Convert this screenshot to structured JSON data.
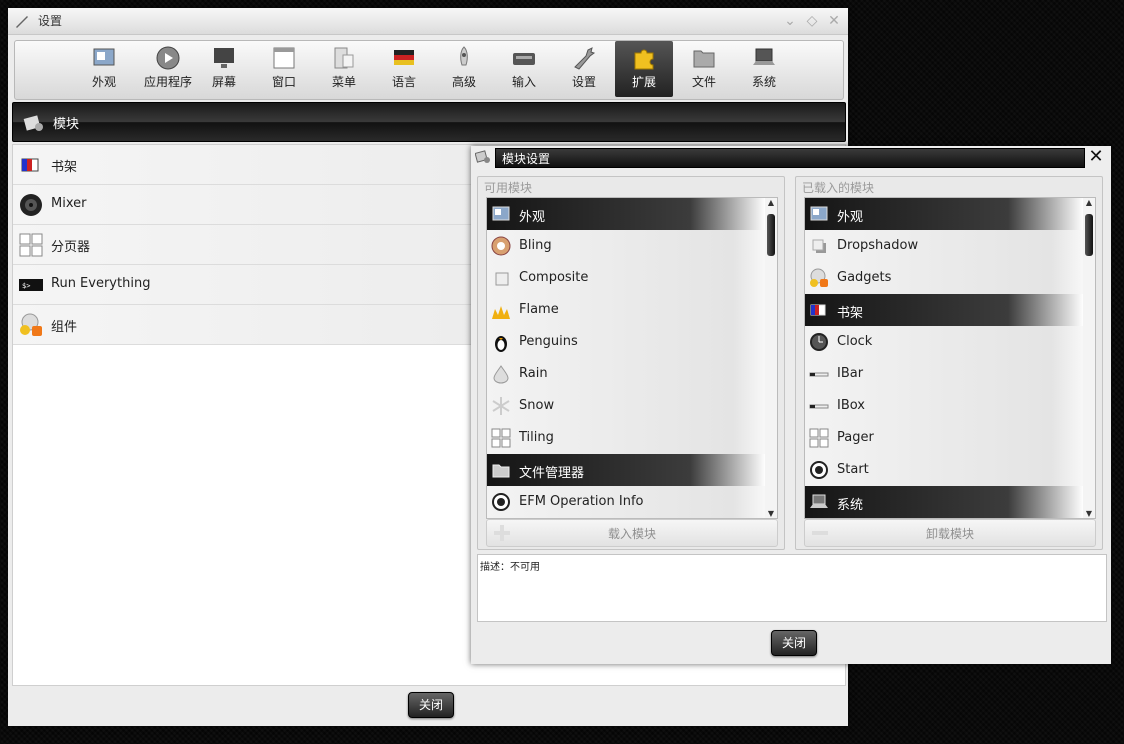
{
  "main_window": {
    "title": "设置",
    "toolbar": [
      {
        "label": "外观",
        "icon": "appearance-icon"
      },
      {
        "label": "应用程序",
        "icon": "applications-icon"
      },
      {
        "label": "屏幕",
        "icon": "screen-icon"
      },
      {
        "label": "窗口",
        "icon": "window-icon"
      },
      {
        "label": "菜单",
        "icon": "menu-icon"
      },
      {
        "label": "语言",
        "icon": "language-flag-icon"
      },
      {
        "label": "高级",
        "icon": "rocket-icon"
      },
      {
        "label": "输入",
        "icon": "input-keyboard-icon"
      },
      {
        "label": "设置",
        "icon": "wrench-icon"
      },
      {
        "label": "扩展",
        "icon": "puzzle-icon",
        "active": true
      },
      {
        "label": "文件",
        "icon": "folder-icon"
      },
      {
        "label": "系统",
        "icon": "laptop-icon"
      }
    ],
    "section_title": "模块",
    "modules": [
      {
        "label": "书架",
        "icon": "shelf-icon"
      },
      {
        "label": "Mixer",
        "icon": "speaker-icon"
      },
      {
        "label": "分页器",
        "icon": "pager-icon"
      },
      {
        "label": "Run Everything",
        "icon": "terminal-icon"
      },
      {
        "label": "组件",
        "icon": "gadgets-icon"
      }
    ],
    "close_label": "关闭"
  },
  "dialog": {
    "title": "模块设置",
    "available": {
      "caption": "可用模块",
      "items": [
        {
          "label": "外观",
          "icon": "appearance-icon",
          "selected": true
        },
        {
          "label": "Bling",
          "icon": "bling-icon"
        },
        {
          "label": "Composite",
          "icon": "composite-icon"
        },
        {
          "label": "Flame",
          "icon": "flame-icon"
        },
        {
          "label": "Penguins",
          "icon": "penguin-icon"
        },
        {
          "label": "Rain",
          "icon": "rain-icon"
        },
        {
          "label": "Snow",
          "icon": "snow-icon"
        },
        {
          "label": "Tiling",
          "icon": "tiling-icon"
        },
        {
          "label": "文件管理器",
          "icon": "folder-icon",
          "selected": true
        },
        {
          "label": "EFM Operation Info",
          "icon": "efm-info-icon"
        }
      ],
      "button_label": "载入模块"
    },
    "loaded": {
      "caption": "已载入的模块",
      "items": [
        {
          "label": "外观",
          "icon": "appearance-icon",
          "selected": true
        },
        {
          "label": "Dropshadow",
          "icon": "dropshadow-icon"
        },
        {
          "label": "Gadgets",
          "icon": "gadgets-icon"
        },
        {
          "label": "书架",
          "icon": "shelf-icon",
          "selected": true
        },
        {
          "label": "Clock",
          "icon": "clock-icon"
        },
        {
          "label": "IBar",
          "icon": "ibar-icon"
        },
        {
          "label": "IBox",
          "icon": "ibox-icon"
        },
        {
          "label": "Pager",
          "icon": "pager-icon"
        },
        {
          "label": "Start",
          "icon": "start-icon"
        },
        {
          "label": "系统",
          "icon": "laptop-icon",
          "selected": true
        }
      ],
      "button_label": "卸载模块"
    },
    "description": "描述：不可用",
    "close_label": "关闭"
  }
}
